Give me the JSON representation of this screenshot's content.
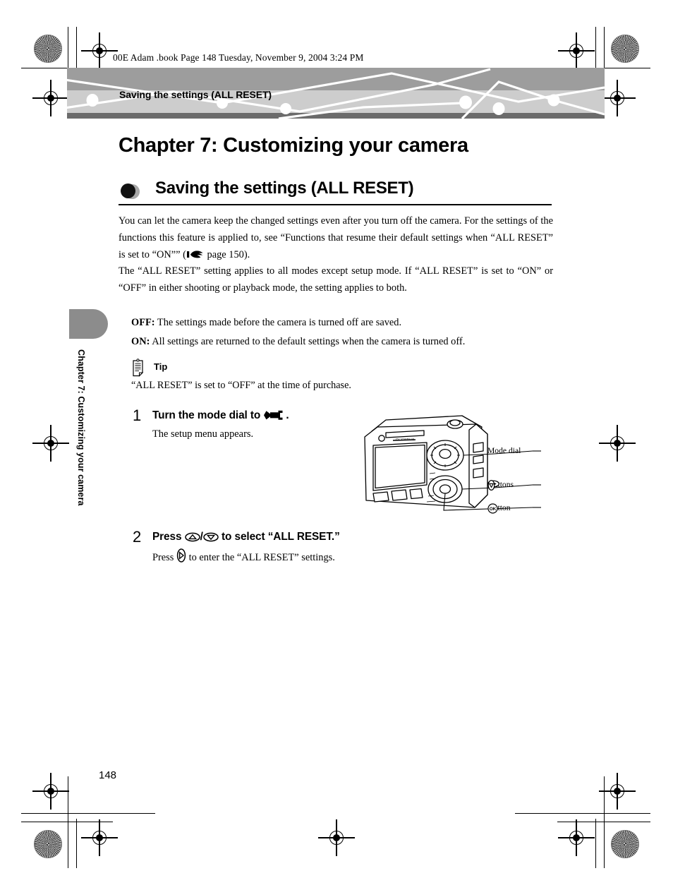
{
  "print_header": {
    "file_line": "00E Adam .book  Page 148  Tuesday, November 9, 2004  3:24 PM"
  },
  "banner": {
    "title": "Saving the settings (ALL RESET)",
    "band_top_color": "#9d9d9d",
    "band_bottom_color": "#cdcdcd",
    "band_edge_color": "#6b6b6b"
  },
  "side_tab": {
    "label": "Chapter 7: Customizing your camera",
    "color": "#8c8c8c"
  },
  "headings": {
    "chapter": "Chapter 7:  Customizing your camera",
    "section": "Saving the settings (ALL RESET)"
  },
  "body": {
    "para1_a": "You can let the camera keep the changed settings even after you turn off the camera. For the settings of the functions this feature is applied to, see “Functions that resume their default settings when “ALL RESET” is set to “ON”” (",
    "para1_b": " page 150).",
    "para2": "The “ALL RESET” setting applies to all modes except setup mode. If “ALL RESET” is set to “ON” or “OFF” in either shooting or playback mode, the setting applies to both."
  },
  "definitions": [
    {
      "term": "OFF:",
      "text": " The settings made before the camera is turned off are saved."
    },
    {
      "term": "ON:",
      "text": " All settings are returned to the default settings when the camera is turned off."
    }
  ],
  "tip": {
    "label": "Tip",
    "text": "“ALL RESET” is set to “OFF” at the time of purchase.",
    "icon": "notepad-icon"
  },
  "steps": [
    {
      "number": "1",
      "main_before": "Turn the mode dial to ",
      "main_after": ".",
      "icon": "wrench-icon",
      "sub": "The setup menu appears."
    },
    {
      "number": "2",
      "main_before": "Press ",
      "main_mid": "/",
      "main_after": " to select “ALL RESET.”",
      "icon_up": "up-arrow-button-icon",
      "icon_down": "down-arrow-button-icon",
      "sub_before": "Press ",
      "sub_after": " to enter the “ALL RESET” settings.",
      "sub_icon": "right-arrow-button-icon"
    }
  ],
  "figure": {
    "name": "camera-rear-illustration",
    "brand_text": "OLYMPUS",
    "callouts": [
      {
        "label": "Mode dial",
        "icons": []
      },
      {
        "label": " buttons",
        "icons": [
          "left-arrow-button-icon",
          "up-arrow-button-icon",
          "right-arrow-button-icon",
          "down-arrow-button-icon"
        ]
      },
      {
        "label": " button",
        "icons": [
          "ok-button-icon"
        ]
      }
    ]
  },
  "page_number": "148"
}
